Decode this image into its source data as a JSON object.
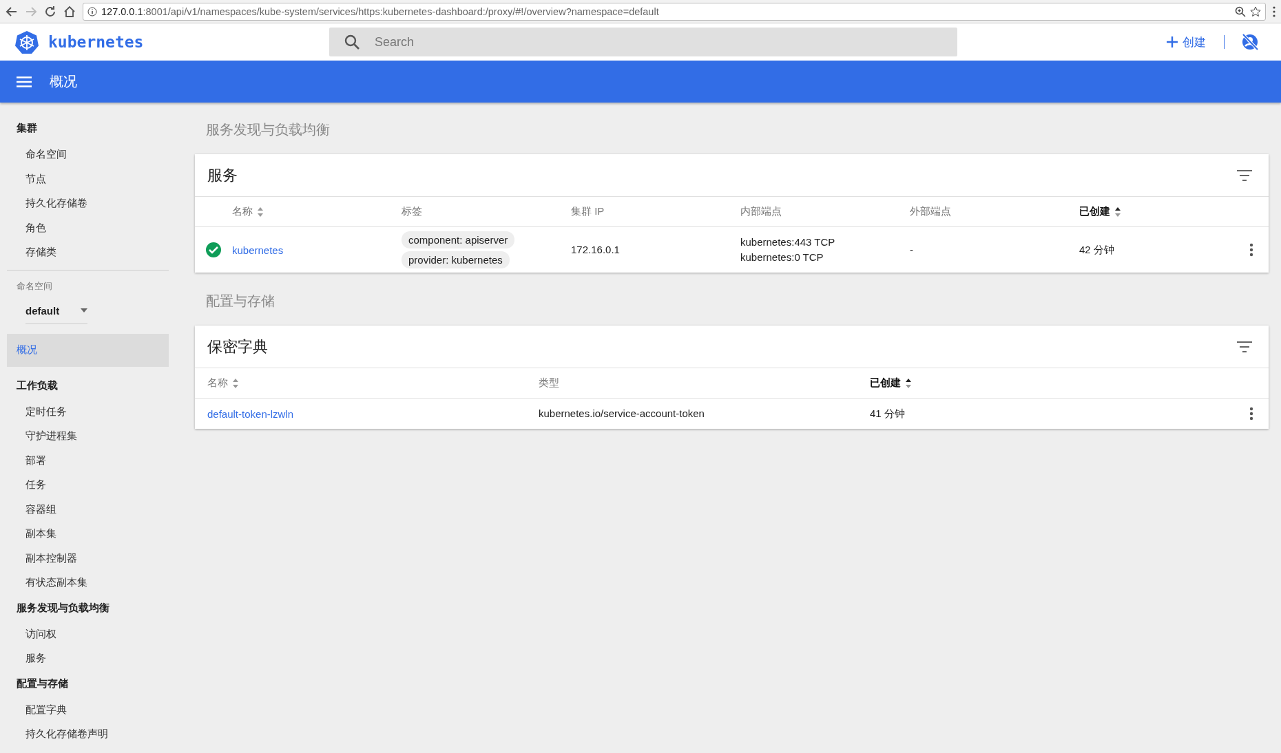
{
  "browser": {
    "url_host": "127.0.0.1",
    "url_rest": ":8001/api/v1/namespaces/kube-system/services/https:kubernetes-dashboard:/proxy/#!/overview?namespace=default"
  },
  "header": {
    "brand": "kubernetes",
    "search": {
      "placeholder": "Search"
    },
    "create_label": "创建"
  },
  "toolbar": {
    "title": "概况"
  },
  "sidebar": {
    "top": [
      {
        "title": "集群",
        "selected": false,
        "items": [
          {
            "label": "命名空间",
            "selected": false
          },
          {
            "label": "节点",
            "selected": false
          },
          {
            "label": "持久化存储卷",
            "selected": false
          },
          {
            "label": "角色",
            "selected": false
          },
          {
            "label": "存储类",
            "selected": false
          }
        ]
      }
    ],
    "namespace": {
      "label": "命名空间",
      "value": "default"
    },
    "sections": [
      {
        "title": "概况",
        "selected": true
      },
      {
        "title": "工作负载",
        "selected": false,
        "items": [
          {
            "label": "定时任务",
            "selected": false
          },
          {
            "label": "守护进程集",
            "selected": false
          },
          {
            "label": "部署",
            "selected": false
          },
          {
            "label": "任务",
            "selected": false
          },
          {
            "label": "容器组",
            "selected": false
          },
          {
            "label": "副本集",
            "selected": false
          },
          {
            "label": "副本控制器",
            "selected": false
          },
          {
            "label": "有状态副本集",
            "selected": false
          }
        ]
      },
      {
        "title": "服务发现与负载均衡",
        "selected": false,
        "items": [
          {
            "label": "访问权",
            "selected": false
          },
          {
            "label": "服务",
            "selected": false
          }
        ]
      },
      {
        "title": "配置与存储",
        "selected": false,
        "items": [
          {
            "label": "配置字典",
            "selected": false
          },
          {
            "label": "持久化存储卷声明",
            "selected": false
          }
        ]
      }
    ]
  },
  "groups": [
    {
      "title": "服务发现与负载均衡",
      "cards": [
        {
          "kind": "services",
          "title": "服务",
          "columns": [
            {
              "label": "名称",
              "sortable": true,
              "sorted": false
            },
            {
              "label": "标签",
              "sortable": false,
              "sorted": false
            },
            {
              "label": "集群 IP",
              "sortable": false,
              "sorted": false
            },
            {
              "label": "内部端点",
              "sortable": false,
              "sorted": false
            },
            {
              "label": "外部端点",
              "sortable": false,
              "sorted": false
            },
            {
              "label": "已创建",
              "sortable": true,
              "sorted": true
            }
          ],
          "rows": [
            {
              "ready": true,
              "name": "kubernetes",
              "labels": [
                "component: apiserver",
                "provider: kubernetes"
              ],
              "cluster_ip": "172.16.0.1",
              "internal_endpoints": [
                "kubernetes:443 TCP",
                "kubernetes:0 TCP"
              ],
              "external_endpoints": "-",
              "created": "42 分钟"
            }
          ]
        }
      ]
    },
    {
      "title": "配置与存储",
      "cards": [
        {
          "kind": "secrets",
          "title": "保密字典",
          "columns": [
            {
              "label": "名称",
              "sortable": true,
              "sorted": false
            },
            {
              "label": "类型",
              "sortable": false,
              "sorted": false
            },
            {
              "label": "已创建",
              "sortable": true,
              "sorted": true
            }
          ],
          "rows": [
            {
              "name": "default-token-lzwln",
              "type": "kubernetes.io/service-account-token",
              "created": "41 分钟"
            }
          ]
        }
      ]
    }
  ]
}
